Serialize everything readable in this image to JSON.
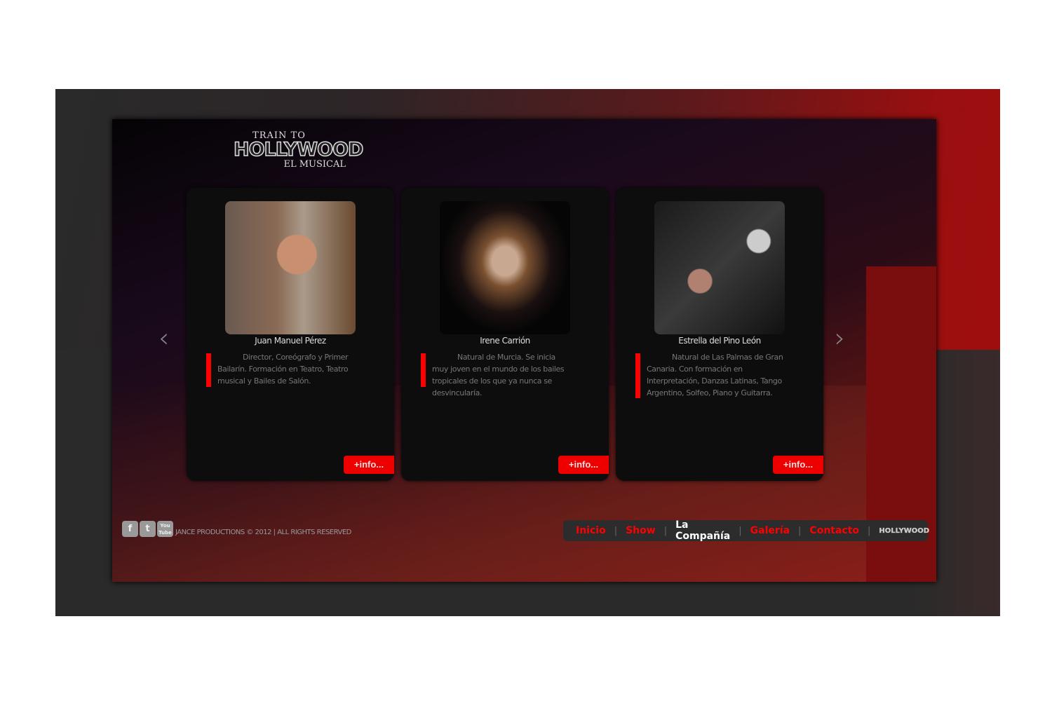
{
  "logo": {
    "line1": "TRAIN TO",
    "line2": "HOLLYWOOD",
    "line3": "EL MUSICAL"
  },
  "cards": [
    {
      "name": "Juan Manuel Pérez",
      "desc": "Director, Coreógrafo y Primer Bailarín. Formación en Teatro, Teatro musical y Bailes de Salón.",
      "button": "+info..."
    },
    {
      "name": "Irene Carrión",
      "desc": "Natural de Murcia. Se inicia muy joven en el mundo de los bailes tropicales de los que ya nunca se desvincularía.",
      "button": "+info..."
    },
    {
      "name": "Estrella del Pino León",
      "desc": "Natural de Las Palmas de Gran Canaria. Con formación en Interpretación, Danzas Latinas, Tango Argentino, Solfeo, Piano y Guitarra.",
      "button": "+info..."
    }
  ],
  "arrows": {
    "prev": "‹",
    "next": "›"
  },
  "footer": {
    "social": [
      "f",
      "t",
      "You Tube"
    ],
    "copyright": "JANCE PRODUCTIONS © 2012 | ALL RIGHTS RESERVED"
  },
  "nav": {
    "items": [
      "Inicio",
      "Show",
      "La Compañía",
      "Galería",
      "Contacto"
    ],
    "active": "La Compañía",
    "mini_logo": "HOLLYWOOD"
  },
  "colors": {
    "accent": "#ff0000",
    "card": "#0d0d0d",
    "nav": "#2c2c2c"
  }
}
